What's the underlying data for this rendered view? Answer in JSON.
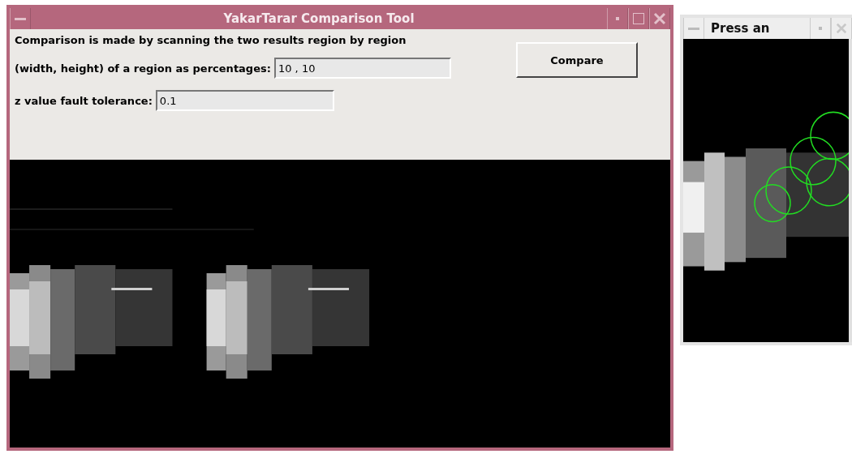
{
  "main_window": {
    "title": "YakarTarar Comparison Tool",
    "description": "Comparison is made by scanning the two results region by region",
    "fields": [
      {
        "label": "(width, height) of a region as percentages:",
        "value": "10 , 10"
      },
      {
        "label": "z value fault tolerance:",
        "value": "0.1"
      }
    ],
    "buttons": [
      "Compare"
    ]
  },
  "preview_window": {
    "title": "Press an"
  }
}
